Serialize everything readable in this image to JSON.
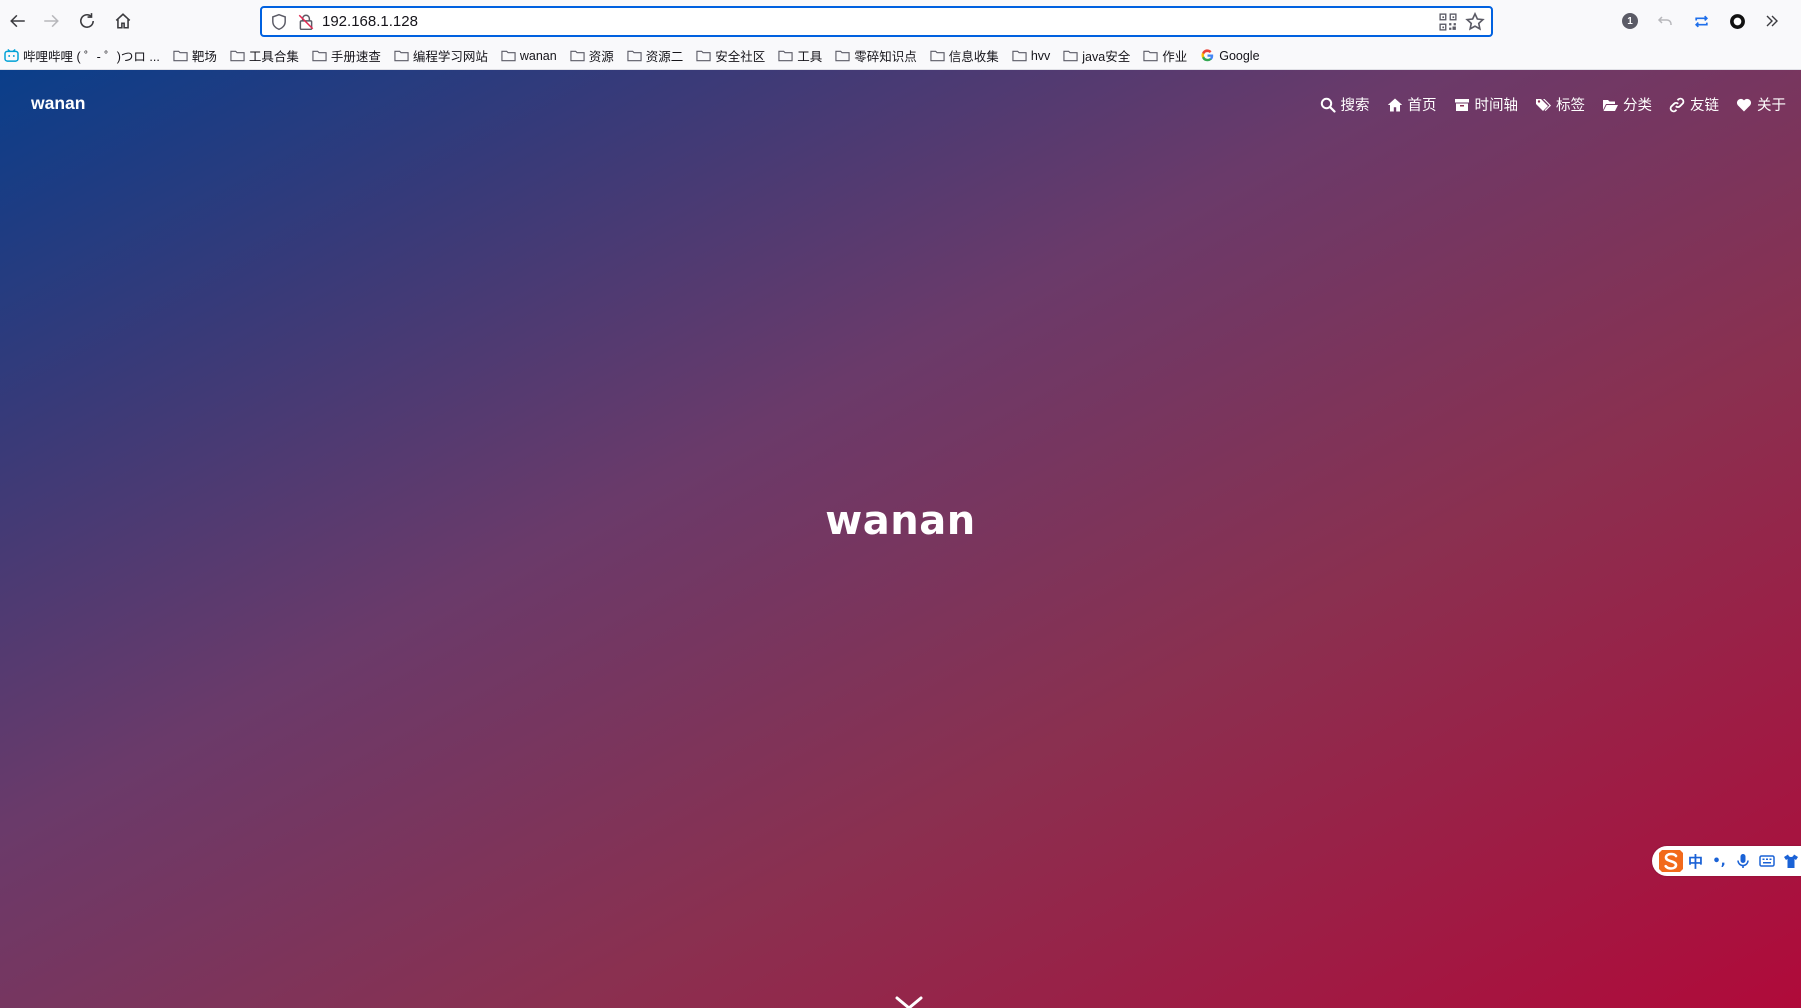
{
  "browser": {
    "url": "192.168.1.128",
    "extension_badge_count": "1",
    "bookmarks": [
      {
        "label": "哔哩哔哩 ( ゜- ゜)つロ ...",
        "icon": "bilibili-icon"
      },
      {
        "label": "靶场",
        "icon": "folder-icon"
      },
      {
        "label": "工具合集",
        "icon": "folder-icon"
      },
      {
        "label": "手册速查",
        "icon": "folder-icon"
      },
      {
        "label": "编程学习网站",
        "icon": "folder-icon"
      },
      {
        "label": "wanan",
        "icon": "folder-icon"
      },
      {
        "label": "资源",
        "icon": "folder-icon"
      },
      {
        "label": "资源二",
        "icon": "folder-icon"
      },
      {
        "label": "安全社区",
        "icon": "folder-icon"
      },
      {
        "label": "工具",
        "icon": "folder-icon"
      },
      {
        "label": "零碎知识点",
        "icon": "folder-icon"
      },
      {
        "label": "信息收集",
        "icon": "folder-icon"
      },
      {
        "label": "hvv",
        "icon": "folder-icon"
      },
      {
        "label": "java安全",
        "icon": "folder-icon"
      },
      {
        "label": "作业",
        "icon": "folder-icon"
      },
      {
        "label": "Google",
        "icon": "google-icon"
      }
    ]
  },
  "site": {
    "brand": "wanan",
    "menu": [
      {
        "label": "搜索",
        "icon": "search-icon"
      },
      {
        "label": "首页",
        "icon": "home-icon"
      },
      {
        "label": "时间轴",
        "icon": "archive-icon"
      },
      {
        "label": "标签",
        "icon": "tags-icon"
      },
      {
        "label": "分类",
        "icon": "folder-open-icon"
      },
      {
        "label": "友链",
        "icon": "link-icon"
      },
      {
        "label": "关于",
        "icon": "heart-icon"
      }
    ],
    "hero_title": "wanan"
  },
  "ime": {
    "mode": "中"
  },
  "colors": {
    "accent": "#0061e0",
    "gradient_start": "#0a3e8a",
    "gradient_end": "#b00a3a",
    "ime_blue": "#1a62d6",
    "ime_logo": "#f26a1b"
  }
}
